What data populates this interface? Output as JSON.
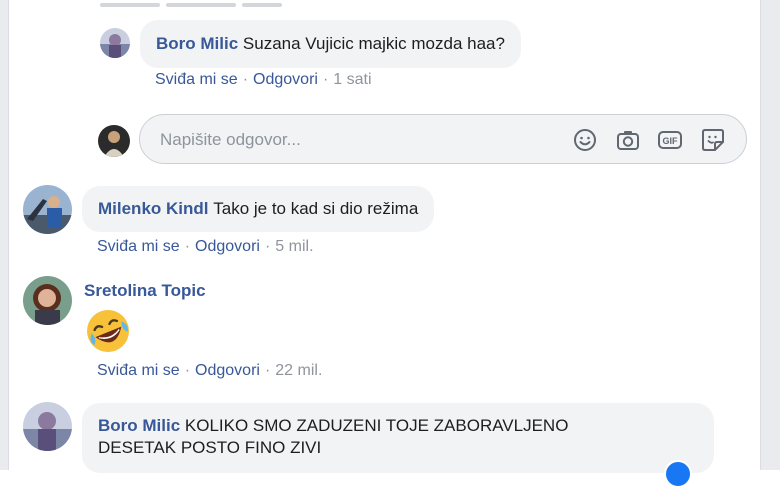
{
  "comments": [
    {
      "author": "Boro Milic",
      "text": "Suzana Vujicic majkic mozda haa?",
      "like_label": "Sviđa mi se",
      "reply_label": "Odgovori",
      "time": "1 sati"
    },
    {
      "author": "Milenko Kindl",
      "text": "Tako je to kad si dio režima",
      "like_label": "Sviđa mi se",
      "reply_label": "Odgovori",
      "time": "5 mil."
    },
    {
      "author": "Sretolina Topic",
      "emoji": "rolling-on-floor-laughing",
      "like_label": "Sviđa mi se",
      "reply_label": "Odgovori",
      "time": "22 mil."
    },
    {
      "author": "Boro Milic",
      "text_line1": "KOLIKO SMO ZADUZENI TOJE ZABORAVLJENO",
      "text_line2": "DESETAK POSTO FINO ZIVI"
    }
  ],
  "reply_box": {
    "placeholder": "Napišite odgovor...",
    "icons": [
      "emoji-icon",
      "camera-icon",
      "gif-icon",
      "sticker-icon"
    ]
  },
  "separator": "·",
  "colors": {
    "author": "#385898",
    "bubble": "#f2f3f5",
    "meta": "#90949c",
    "frame": "#e9ebee"
  }
}
